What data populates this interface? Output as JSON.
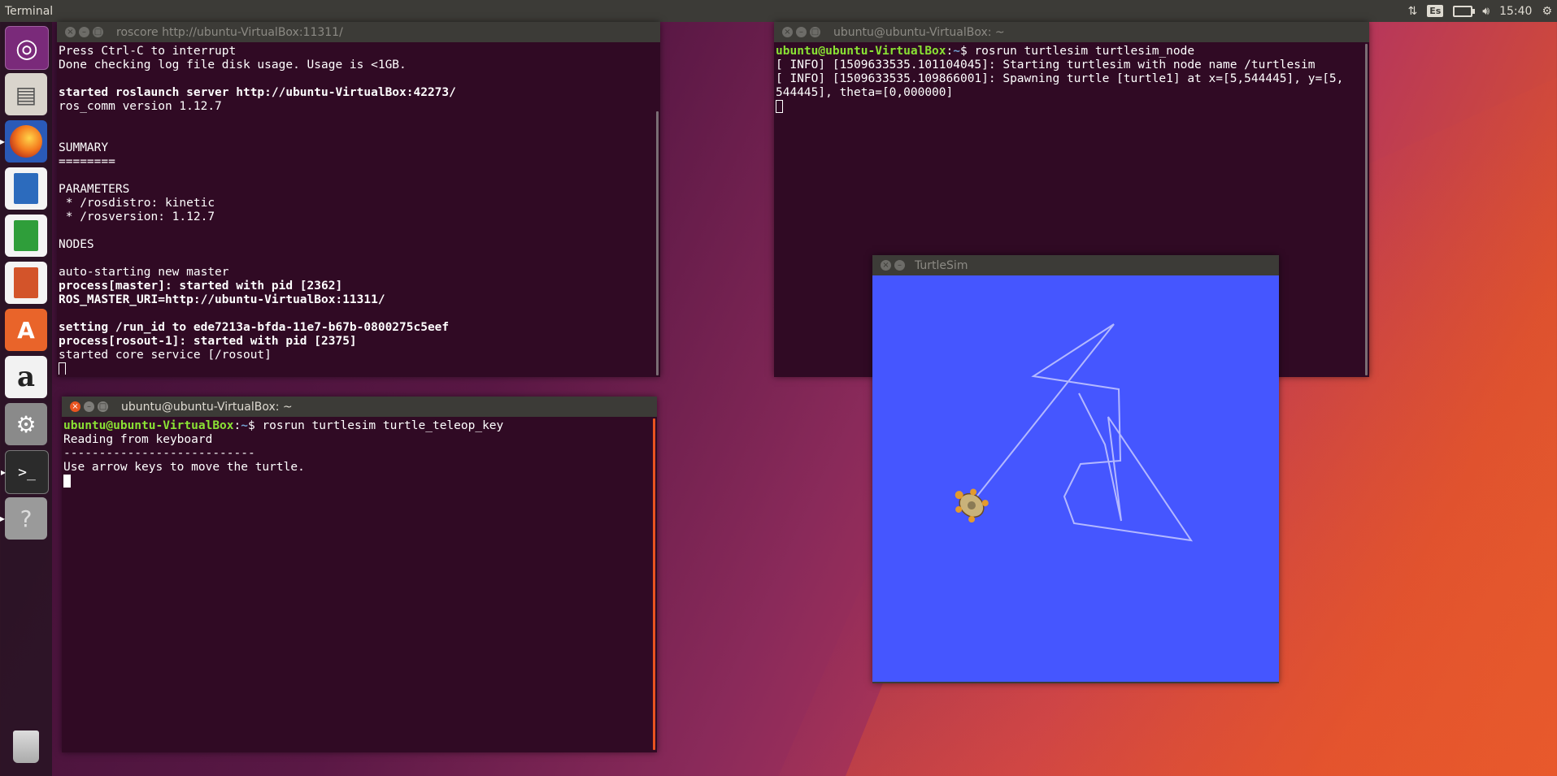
{
  "topbar": {
    "app_title": "Terminal",
    "keyboard_layout": "Es",
    "clock": "15:40"
  },
  "launcher": {
    "items": [
      {
        "name": "ubuntu-dash-icon",
        "glyph": "◎"
      },
      {
        "name": "files-icon",
        "glyph": "▤"
      },
      {
        "name": "firefox-icon",
        "glyph": "●"
      },
      {
        "name": "writer-icon",
        "glyph": "▦"
      },
      {
        "name": "calc-icon",
        "glyph": "▦"
      },
      {
        "name": "impress-icon",
        "glyph": "▦"
      },
      {
        "name": "software-center-icon",
        "glyph": "A"
      },
      {
        "name": "amazon-icon",
        "glyph": "a"
      },
      {
        "name": "settings-icon",
        "glyph": "⚙"
      },
      {
        "name": "terminal-icon",
        "glyph": ">_"
      },
      {
        "name": "help-icon",
        "glyph": "?"
      },
      {
        "name": "trash-icon",
        "glyph": "🗑"
      }
    ]
  },
  "roscore_window": {
    "title": "roscore http://ubuntu-VirtualBox:11311/",
    "lines": [
      {
        "text": "Press Ctrl-C to interrupt",
        "bold": false
      },
      {
        "text": "Done checking log file disk usage. Usage is <1GB.",
        "bold": false
      },
      {
        "text": "",
        "bold": false
      },
      {
        "text": "started roslaunch server http://ubuntu-VirtualBox:42273/",
        "bold": true
      },
      {
        "text": "ros_comm version 1.12.7",
        "bold": false
      },
      {
        "text": "",
        "bold": false
      },
      {
        "text": "",
        "bold": false
      },
      {
        "text": "SUMMARY",
        "bold": false
      },
      {
        "text": "========",
        "bold": false
      },
      {
        "text": "",
        "bold": false
      },
      {
        "text": "PARAMETERS",
        "bold": false
      },
      {
        "text": " * /rosdistro: kinetic",
        "bold": false
      },
      {
        "text": " * /rosversion: 1.12.7",
        "bold": false
      },
      {
        "text": "",
        "bold": false
      },
      {
        "text": "NODES",
        "bold": false
      },
      {
        "text": "",
        "bold": false
      },
      {
        "text": "auto-starting new master",
        "bold": false
      },
      {
        "text": "process[master]: started with pid [2362]",
        "bold": true
      },
      {
        "text": "ROS_MASTER_URI=http://ubuntu-VirtualBox:11311/",
        "bold": true
      },
      {
        "text": "",
        "bold": false
      },
      {
        "text": "setting /run_id to ede7213a-bfda-11e7-b67b-0800275c5eef",
        "bold": true
      },
      {
        "text": "process[rosout-1]: started with pid [2375]",
        "bold": true
      },
      {
        "text": "started core service [/rosout]",
        "bold": false
      }
    ]
  },
  "teleop_window": {
    "title": "ubuntu@ubuntu-VirtualBox: ~",
    "prompt_user": "ubuntu@ubuntu-VirtualBox",
    "prompt_sep": ":",
    "prompt_path": "~",
    "prompt_end": "$ ",
    "command": "rosrun turtlesim turtle_teleop_key",
    "lines": [
      "Reading from keyboard",
      "---------------------------",
      "Use arrow keys to move the turtle."
    ]
  },
  "node_window": {
    "title": "ubuntu@ubuntu-VirtualBox: ~",
    "prompt_user": "ubuntu@ubuntu-VirtualBox",
    "prompt_sep": ":",
    "prompt_path": "~",
    "prompt_end": "$ ",
    "command": "rosrun turtlesim turtlesim_node",
    "lines": [
      "[ INFO] [1509633535.101104045]: Starting turtlesim with node name /turtlesim",
      "[ INFO] [1509633535.109866001]: Spawning turtle [turtle1] at x=[5,544445], y=[5,",
      "544445], theta=[0,000000]"
    ]
  },
  "turtlesim_window": {
    "title": "TurtleSim",
    "background_color": "#4556ff",
    "path_color": "#b3b8ff",
    "turtle_position": {
      "x": 3.3,
      "y": 4.1
    }
  }
}
